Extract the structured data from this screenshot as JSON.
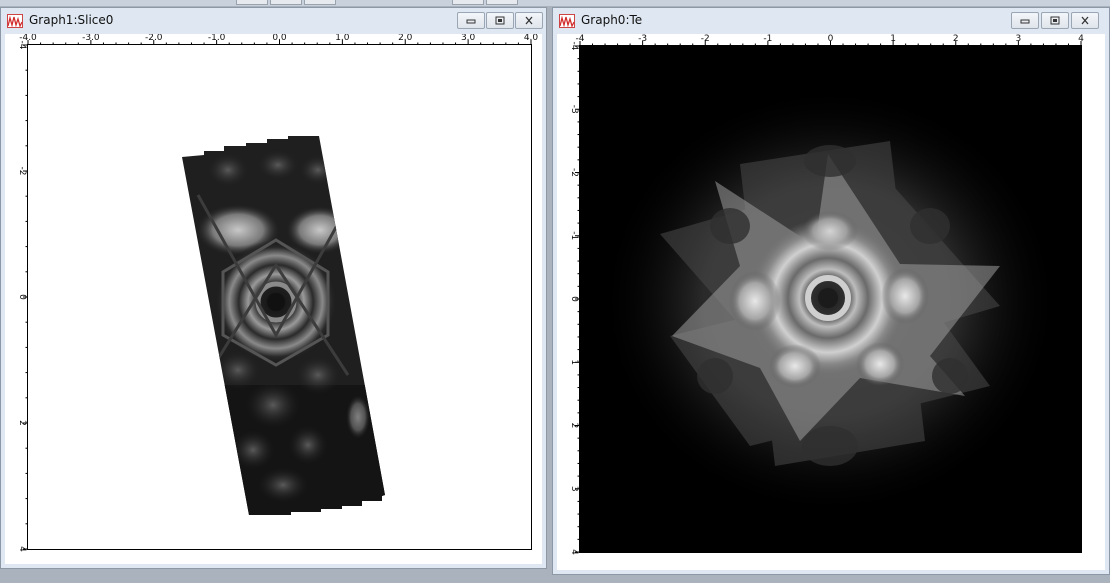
{
  "windows": [
    {
      "id": "graph1",
      "title": "Graph1:Slice0",
      "x_ticks": [
        "-4.0",
        "-3.0",
        "-2.0",
        "-1.0",
        "0.0",
        "1.0",
        "2.0",
        "3.0",
        "4.0"
      ],
      "y_ticks": [
        "-4",
        "-2",
        "0",
        "2",
        "4"
      ],
      "x_tick_values": [
        -4,
        -3,
        -2,
        -1,
        0,
        1,
        2,
        3,
        4
      ],
      "y_tick_values": [
        -4,
        -2,
        0,
        2,
        4
      ],
      "xlim": [
        -4,
        4
      ],
      "ylim": [
        -4,
        4
      ],
      "image_background": "#ffffff"
    },
    {
      "id": "graph0",
      "title": "Graph0:Te",
      "x_ticks": [
        "-4",
        "-3",
        "-2",
        "-1",
        "0",
        "1",
        "2",
        "3",
        "4"
      ],
      "y_ticks": [
        "-4",
        "-3",
        "-2",
        "-1",
        "0",
        "1",
        "2",
        "3",
        "4"
      ],
      "x_tick_values": [
        -4,
        -3,
        -2,
        -1,
        0,
        1,
        2,
        3,
        4
      ],
      "y_tick_values": [
        -4,
        -3,
        -2,
        -1,
        0,
        1,
        2,
        3,
        4
      ],
      "xlim": [
        -4,
        4
      ],
      "ylim": [
        -4,
        4
      ],
      "image_background": "#000000"
    }
  ],
  "colors": {
    "window_frame": "#dfe8f2",
    "app_icon": "#d22c2c",
    "desktop": "#aab3bd"
  }
}
